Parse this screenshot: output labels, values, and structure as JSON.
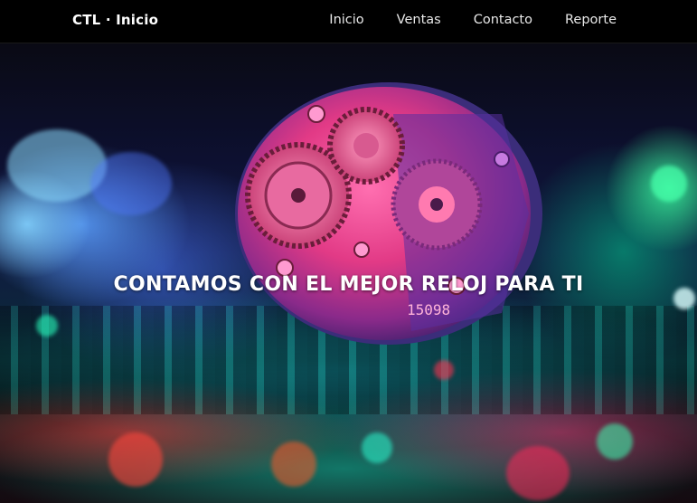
{
  "navbar": {
    "brand": "CTL · Inicio",
    "links": [
      {
        "label": "Inicio"
      },
      {
        "label": "Ventas"
      },
      {
        "label": "Contacto"
      },
      {
        "label": "Reporte"
      }
    ]
  },
  "hero": {
    "title": "CONTAMOS CON EL MEJOR RELOJ PARA TI",
    "background_image": "watch-movement-photo",
    "watch_engraving": "15098"
  },
  "colors": {
    "navbar_bg": "#000000",
    "text": "#ffffff",
    "accent_pink": "#ff3fb0",
    "accent_green": "#2dffb0",
    "accent_blue": "#5a7bff"
  }
}
